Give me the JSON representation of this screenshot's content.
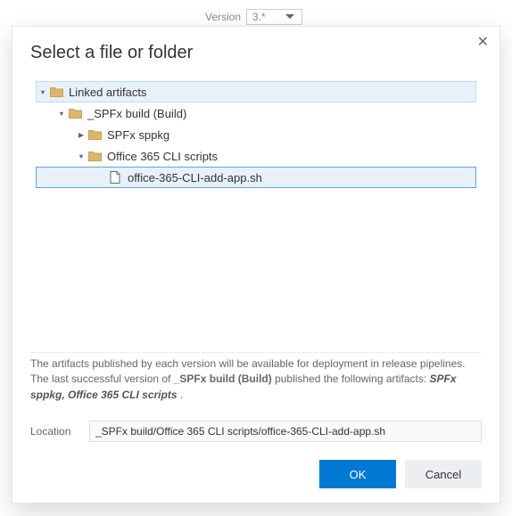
{
  "backdrop": {
    "version_label": "Version",
    "version_value": "3.*"
  },
  "dialog": {
    "title": "Select a file or folder",
    "close_glyph": "✕",
    "tree": {
      "root": {
        "label": "Linked artifacts"
      },
      "build": {
        "label": "_SPFx build (Build)"
      },
      "sppkg": {
        "label": "SPFx sppkg"
      },
      "scripts": {
        "label": "Office 365 CLI scripts"
      },
      "file": {
        "label": "office-365-CLI-add-app.sh"
      }
    },
    "info": {
      "pre": "The artifacts published by each version will be available for deployment in release pipelines. The last successful version of ",
      "build_name": "_SPFx build (Build)",
      "mid": " published the following artifacts: ",
      "artifacts": "SPFx sppkg, Office 365 CLI scripts",
      "post": "."
    },
    "location": {
      "label": "Location",
      "value": "_SPFx build/Office 365 CLI scripts/office-365-CLI-add-app.sh"
    },
    "buttons": {
      "ok": "OK",
      "cancel": "Cancel"
    }
  }
}
